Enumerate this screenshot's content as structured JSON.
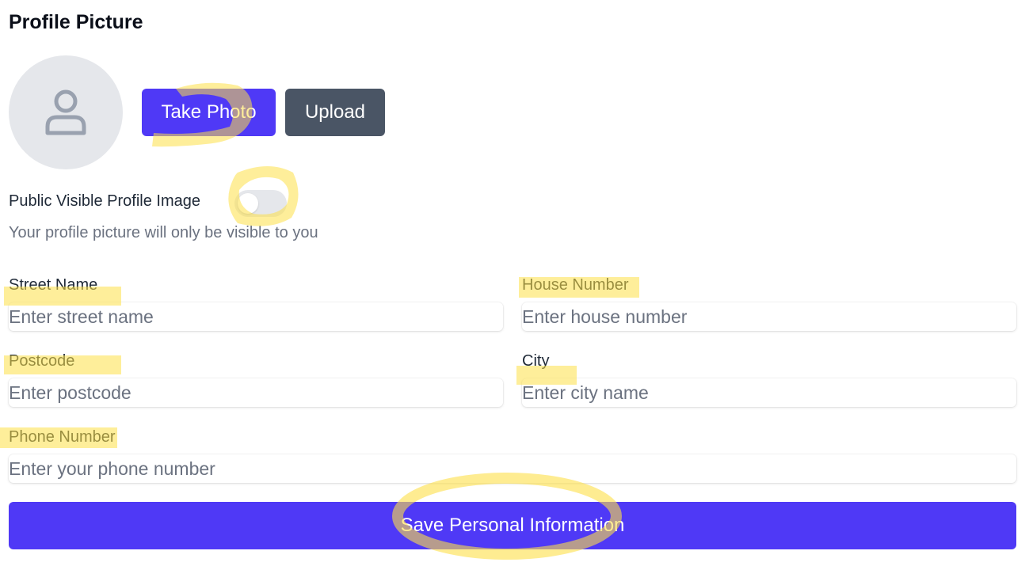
{
  "profile": {
    "title": "Profile Picture",
    "avatar_icon": "user-icon",
    "take_photo_label": "Take Photo",
    "upload_label": "Upload",
    "visibility_label": "Public Visible Profile Image",
    "visibility_enabled": false,
    "visibility_helper": "Your profile picture will only be visible to you"
  },
  "form": {
    "street": {
      "label": "Street Name",
      "placeholder": "Enter street name",
      "value": ""
    },
    "house": {
      "label": "House Number",
      "placeholder": "Enter house number",
      "value": ""
    },
    "postcode": {
      "label": "Postcode",
      "placeholder": "Enter postcode",
      "value": ""
    },
    "city": {
      "label": "City",
      "placeholder": "Enter city name",
      "value": ""
    },
    "phone": {
      "label": "Phone Number",
      "placeholder": "Enter your phone number",
      "value": ""
    },
    "save_label": "Save Personal Information"
  },
  "colors": {
    "primary": "#4f39f6",
    "secondary": "#4a5565",
    "avatar_bg": "#e5e7eb",
    "annotation_highlight": "#fde047"
  }
}
